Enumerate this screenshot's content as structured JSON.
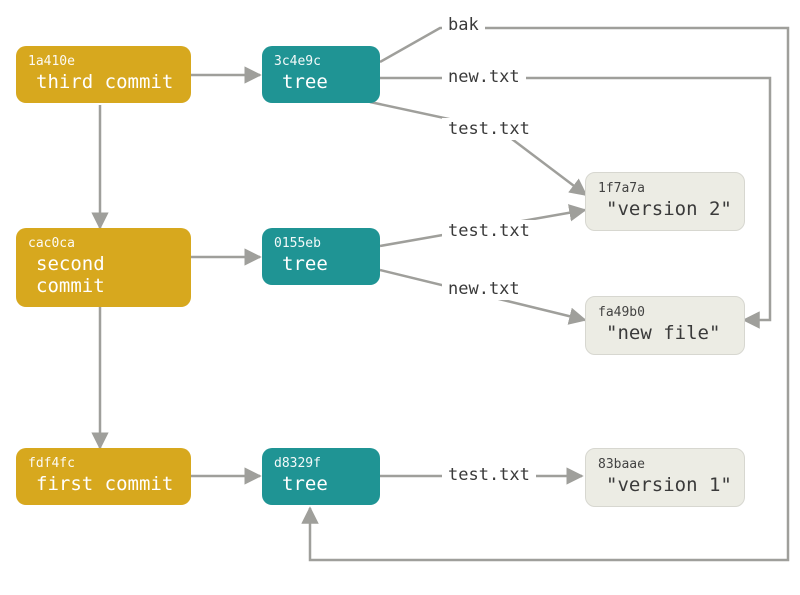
{
  "commits": [
    {
      "hash": "1a410e",
      "title": "third commit"
    },
    {
      "hash": "cac0ca",
      "title": "second commit"
    },
    {
      "hash": "fdf4fc",
      "title": "first commit"
    }
  ],
  "trees": [
    {
      "hash": "3c4e9c",
      "title": "tree"
    },
    {
      "hash": "0155eb",
      "title": "tree"
    },
    {
      "hash": "d8329f",
      "title": "tree"
    }
  ],
  "blobs": [
    {
      "hash": "1f7a7a",
      "title": "\"version 2\""
    },
    {
      "hash": "fa49b0",
      "title": "\"new file\""
    },
    {
      "hash": "83baae",
      "title": "\"version 1\""
    }
  ],
  "edge_labels": {
    "bak": "bak",
    "new_txt_top": "new.txt",
    "test_txt_top": "test.txt",
    "test_txt_mid": "test.txt",
    "new_txt_mid": "new.txt",
    "test_txt_bot": "test.txt"
  },
  "colors": {
    "commit": "#d7a81e",
    "tree": "#1f9494",
    "blob_bg": "#ecece4",
    "arrow": "#9f9f9b"
  }
}
